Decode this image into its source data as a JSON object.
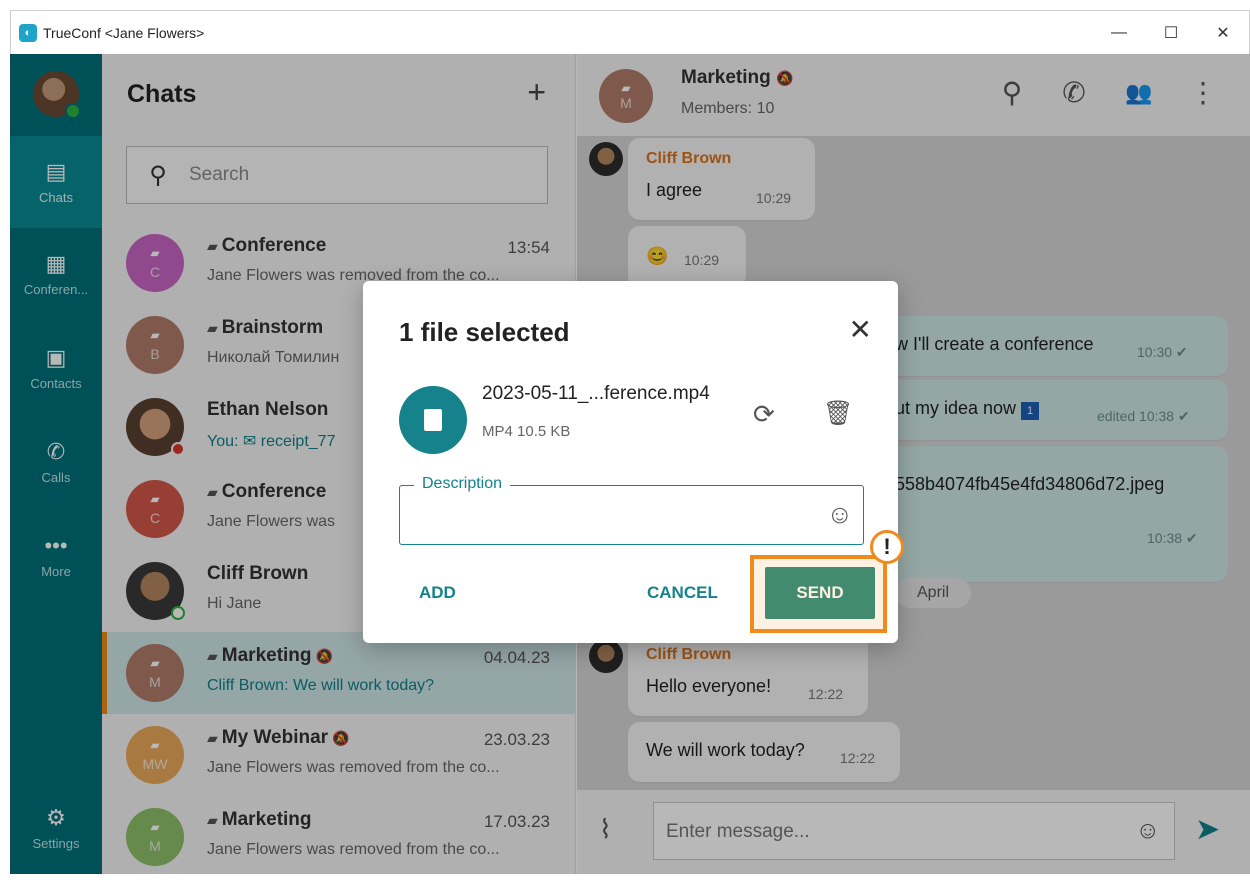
{
  "window": {
    "title": "TrueConf <Jane Flowers>",
    "minimize": "—",
    "maximize": "☐",
    "close": "✕"
  },
  "rail": {
    "items": [
      {
        "label": "Chats",
        "icon": "chat-icon"
      },
      {
        "label": "Conferen...",
        "icon": "conference-icon"
      },
      {
        "label": "Contacts",
        "icon": "contacts-icon"
      },
      {
        "label": "Calls",
        "icon": "calls-icon"
      },
      {
        "label": "More",
        "icon": "more-icon"
      },
      {
        "label": "Settings",
        "icon": "gear-icon"
      }
    ]
  },
  "chats": {
    "title": "Chats",
    "add": "+",
    "search_placeholder": "Search",
    "items": [
      {
        "initials": "C",
        "name": "Conference",
        "time": "13:54",
        "preview": "Jane Flowers was removed from the co...",
        "color": "#c766c2"
      },
      {
        "initials": "B",
        "name": "Brainstorm",
        "time": "",
        "preview": "Николай Томилин",
        "color": "#b07c6a"
      },
      {
        "initials": "",
        "name": "Ethan Nelson",
        "time": "",
        "preview": "You: ✉ receipt_77",
        "color": "#8a6b55"
      },
      {
        "initials": "C",
        "name": "Conference",
        "time": "",
        "preview": "Jane Flowers was",
        "color": "#d2584a"
      },
      {
        "initials": "",
        "name": "Cliff Brown",
        "time": "",
        "preview": "Hi Jane",
        "color": "#4a4a4a"
      },
      {
        "initials": "M",
        "name": "Marketing",
        "time": "04.04.23",
        "preview_sender": "Cliff Brown:",
        "preview": "We will work today?",
        "color": "#b07c6a"
      },
      {
        "initials": "MW",
        "name": "My Webinar",
        "time": "23.03.23",
        "preview": "Jane Flowers was removed from the co...",
        "color": "#e9a85a"
      },
      {
        "initials": "M",
        "name": "Marketing",
        "time": "17.03.23",
        "preview": "Jane Flowers was removed from the co...",
        "color": "#8cbf6a"
      }
    ]
  },
  "chat": {
    "name": "Marketing",
    "members": "Members: 10",
    "initials": "M",
    "messages": {
      "m1_sender": "Cliff Brown",
      "m1_text": "I agree",
      "m1_time": "10:29",
      "m2_text": "😊",
      "m2_time": "10:29",
      "m3_text": "w I'll create a conference",
      "m3_time": "10:30 ✔",
      "m4_text": "ut my idea now",
      "m4_time": "edited 10:38 ✔",
      "m5_text": "558b4074fb45e4fd34806d72.jpeg",
      "m5_time": "10:38 ✔",
      "date_chip": "April",
      "m6_sender": "Cliff Brown",
      "m6_text": "Hello everyone!",
      "m6_time": "12:22",
      "m7_text": "We will work today?",
      "m7_time": "12:22"
    },
    "composer_placeholder": "Enter message..."
  },
  "modal": {
    "title": "1 file selected",
    "file_name": "2023-05-11_...ference.mp4",
    "file_meta": "MP4 10.5 KB",
    "description_label": "Description",
    "add": "ADD",
    "cancel": "CANCEL",
    "send": "SEND",
    "warn": "!"
  },
  "colors": {
    "rail": "#00707a",
    "accent": "#15828c",
    "highlight": "#f08a1c"
  }
}
